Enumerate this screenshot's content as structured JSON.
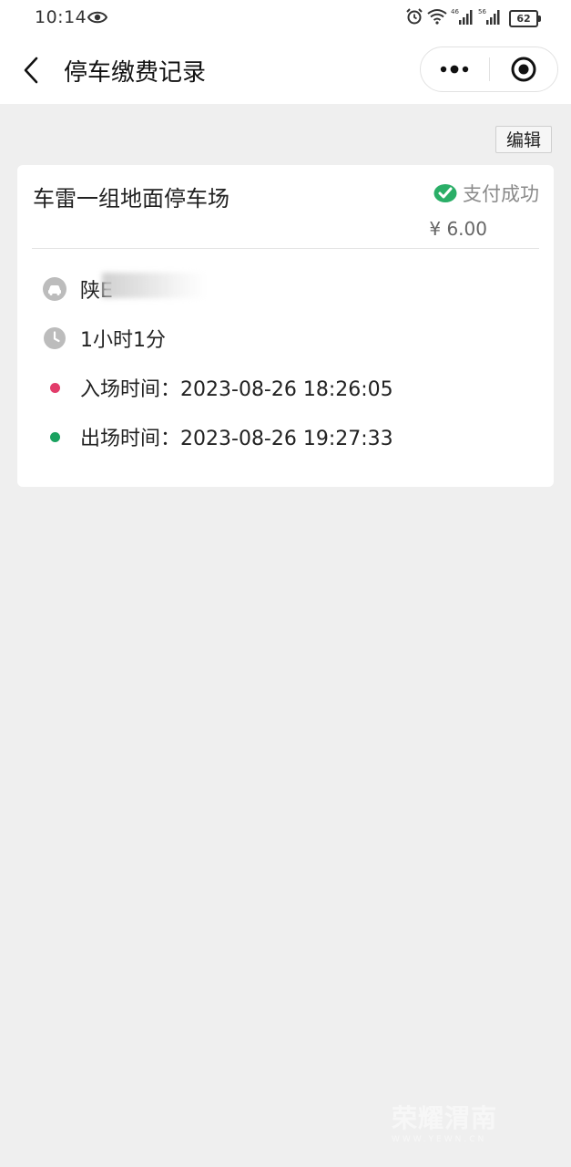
{
  "status_bar": {
    "time": "10:14",
    "battery": "62",
    "net1": "4G",
    "net2": "5G"
  },
  "nav": {
    "title": "停车缴费记录",
    "more_icon": "more-dots-icon",
    "close_icon": "target-icon"
  },
  "edit_label": "编辑",
  "record": {
    "lot_name": "车雷一组地面停车场",
    "status": "支付成功",
    "amount": "¥ 6.00",
    "plate": "陕E",
    "duration": "1小时1分",
    "entry_label": "入场时间：",
    "entry_time": "2023-08-26 18:26:05",
    "exit_label": "出场时间：",
    "exit_time": "2023-08-26 19:27:33"
  },
  "colors": {
    "success_green": "#2aae67",
    "entry_dot": "#e23c6a",
    "exit_dot": "#1aa260",
    "icon_grey": "#bcbcbc"
  },
  "watermark": {
    "title": "荣耀渭南",
    "url": "WWW.YEWN.CN"
  }
}
